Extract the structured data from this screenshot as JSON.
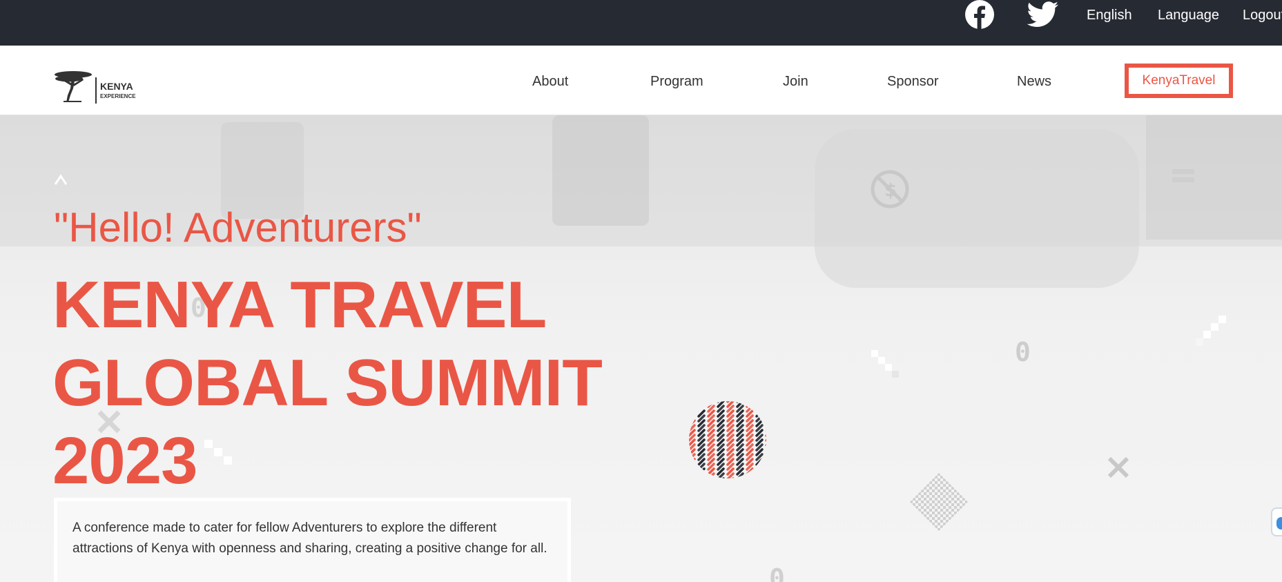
{
  "topbar": {
    "social": [
      {
        "name": "facebook",
        "icon": "facebook-icon"
      },
      {
        "name": "twitter",
        "icon": "twitter-icon"
      }
    ],
    "links": {
      "english": "English",
      "language": "Language",
      "logout": "Logout"
    }
  },
  "nav": {
    "logo": {
      "title": "KENYA",
      "subtitle": "EXPERIENCE",
      "icon": "acacia-tree-icon"
    },
    "items": [
      "About",
      "Program",
      "Join",
      "Sponsor",
      "News"
    ],
    "cta": "KenyaTravel"
  },
  "hero": {
    "greeting": "\"Hello! Adventurers\"",
    "title_lines": [
      "KENYA TRAVEL",
      "GLOBAL SUMMIT",
      "2023"
    ],
    "description": "A conference made to cater for fellow Adventurers to explore the different attractions of Kenya with openness and sharing, creating a positive change for all."
  },
  "colors": {
    "accent": "#ea5645",
    "topbar": "#262a33",
    "nav_bg": "#ffffff",
    "text": "#333333"
  }
}
